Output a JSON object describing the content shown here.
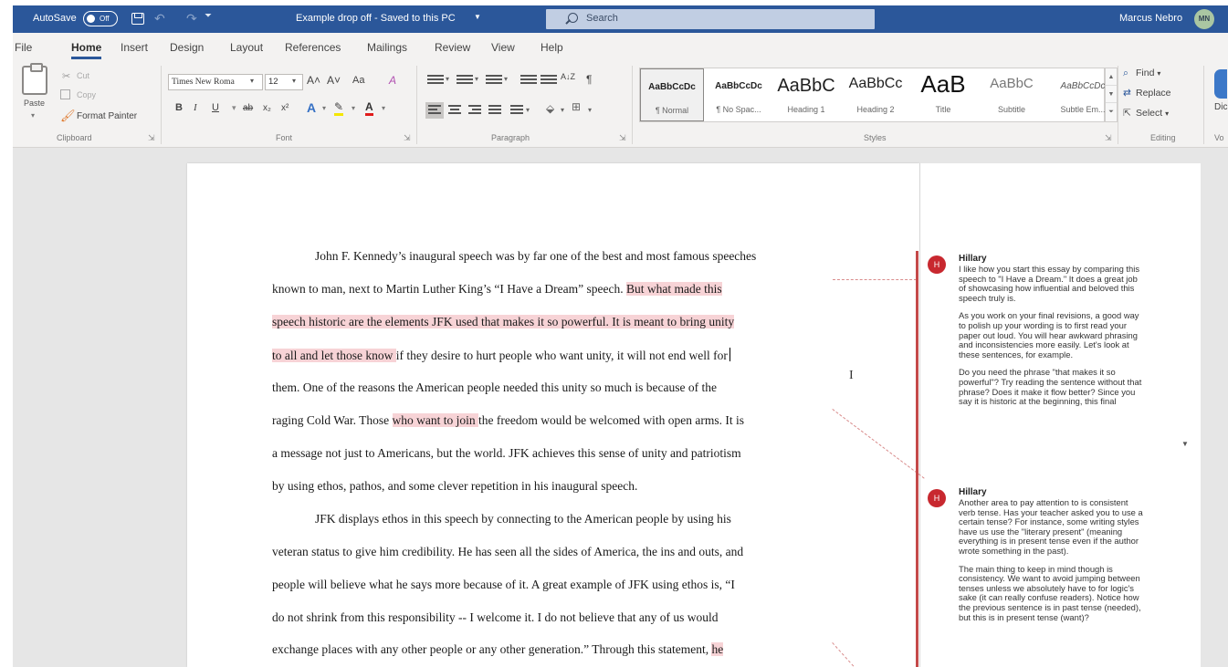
{
  "titlebar": {
    "autosave_label": "AutoSave",
    "autosave_state": "Off",
    "doc_title": "Example drop off  -  Saved to this PC",
    "search_placeholder": "Search",
    "user_name": "Marcus Nebro",
    "user_initials": "MN",
    "color": "#2b579a"
  },
  "tabs": [
    "File",
    "Home",
    "Insert",
    "Design",
    "Layout",
    "References",
    "Mailings",
    "Review",
    "View",
    "Help"
  ],
  "active_tab": "Home",
  "ribbon": {
    "clipboard": {
      "group": "Clipboard",
      "paste": "Paste",
      "cut": "Cut",
      "copy": "Copy",
      "format_painter": "Format Painter"
    },
    "font": {
      "group": "Font",
      "font_name": "Times New Roma",
      "font_size": "12",
      "grow": "A˄",
      "shrink": "A˅",
      "case": "Aa",
      "clear": "A",
      "bold": "B",
      "italic": "I",
      "underline": "U",
      "strike": "ab",
      "subscript": "x₂",
      "superscript": "x²",
      "text_effects": "A",
      "highlight": "✎",
      "font_color": "A"
    },
    "paragraph": {
      "group": "Paragraph",
      "sort": "A↓Z",
      "pilcrow": "¶"
    },
    "styles": {
      "group": "Styles",
      "items": [
        {
          "preview": "AaBbCcDc",
          "name": "¶ Normal"
        },
        {
          "preview": "AaBbCcDc",
          "name": "¶ No Spac..."
        },
        {
          "preview": "AaBbC",
          "name": "Heading 1"
        },
        {
          "preview": "AaBbCc",
          "name": "Heading 2"
        },
        {
          "preview": "AaB",
          "name": "Title"
        },
        {
          "preview": "AaBbC",
          "name": "Subtitle"
        },
        {
          "preview": "AaBbCcDc",
          "name": "Subtle Em..."
        }
      ]
    },
    "editing": {
      "group": "Editing",
      "find": "Find",
      "replace": "Replace",
      "select": "Select"
    },
    "voice": {
      "dictate": "Dic",
      "group": "Vo"
    }
  },
  "document": {
    "lines": [
      {
        "parts": [
          {
            "text": "John F. Kennedy’s inaugural speech was by far one of the best and most famous speeches",
            "hl": false
          }
        ]
      },
      {
        "parts": [
          {
            "text": "known to man, next to Martin Luther King’s “I Have a Dream” speech.  ",
            "hl": false
          },
          {
            "text": "But what made this",
            "hl": true
          }
        ]
      },
      {
        "parts": [
          {
            "text": "speech historic are the elements JFK used that makes it so powerful.   It is meant to bring unity",
            "hl": true
          }
        ]
      },
      {
        "parts": [
          {
            "text": "to all and let those know ",
            "hl": true
          },
          {
            "text": "if they desire to hurt people who want unity, it will not end well for",
            "hl": false
          }
        ]
      },
      {
        "parts": [
          {
            "text": "them.  One of the reasons the American people needed this unity so much is because of the",
            "hl": false
          }
        ]
      },
      {
        "parts": [
          {
            "text": "raging Cold War.  Those ",
            "hl": false
          },
          {
            "text": "who want to join ",
            "hl": true
          },
          {
            "text": "the freedom would be welcomed with open arms.  It is",
            "hl": false
          }
        ]
      },
      {
        "parts": [
          {
            "text": "a message not just to Americans, but the world.   JFK achieves this sense of unity and patriotism",
            "hl": false
          }
        ]
      },
      {
        "parts": [
          {
            "text": "by using ethos, pathos, and some clever repetition in his inaugural speech.",
            "hl": false
          }
        ]
      },
      {
        "parts": [
          {
            "text": "JFK displays ethos in this speech by connecting to the American people by using his",
            "hl": false
          }
        ]
      },
      {
        "parts": [
          {
            "text": "veteran status to give him credibility.  He has seen all the sides of America, the ins and outs, and",
            "hl": false
          }
        ]
      },
      {
        "parts": [
          {
            "text": "people will believe what he says more because of it.  A great example of JFK using ethos is, “I",
            "hl": false
          }
        ]
      },
      {
        "parts": [
          {
            "text": "do not shrink from this responsibility -- I welcome it. I do not believe that any of us would",
            "hl": false
          }
        ]
      },
      {
        "parts": [
          {
            "text": "exchange places with any other people or any other generation.”  Through this statement, ",
            "hl": false
          },
          {
            "text": "he",
            "hl": true
          }
        ]
      }
    ],
    "highlight_color": "#f7d3d6"
  },
  "comments": [
    {
      "initial": "H",
      "author": "Hillary",
      "paragraphs": [
        [
          "I like how you start this essay by comparing this",
          "speech to \"I Have a Dream.\" It does a great job",
          "of showcasing how influential and beloved this",
          "speech truly is."
        ],
        [
          "As you work on your final revisions, a good way",
          "to polish up your wording is to first read your",
          "paper out loud. You will hear awkward phrasing",
          "and inconsistencies more easily. Let's look at",
          "these sentences, for example."
        ],
        [
          "Do you need the phrase \"that makes it so",
          "powerful\"? Try reading the sentence without that",
          "phrase? Does it make it flow better? Since you",
          "say it is historic at the beginning, this final"
        ]
      ]
    },
    {
      "initial": "H",
      "author": "Hillary",
      "paragraphs": [
        [
          "Another area to pay attention to is consistent",
          "verb tense. Has your teacher asked you to use a",
          "certain tense? For instance, some writing styles",
          "have us use the \"literary present\" (meaning",
          "everything is in present tense even if the author",
          "wrote something in the past)."
        ],
        [
          "The main thing to keep in mind though is",
          "consistency. We want to avoid jumping between",
          "tenses unless we absolutely have to for logic's",
          "sake (it can really confuse readers). Notice how",
          "the previous sentence is in past tense (needed),",
          "but this is in present tense (want)?"
        ]
      ]
    }
  ],
  "comment_accent": "#c8282f"
}
